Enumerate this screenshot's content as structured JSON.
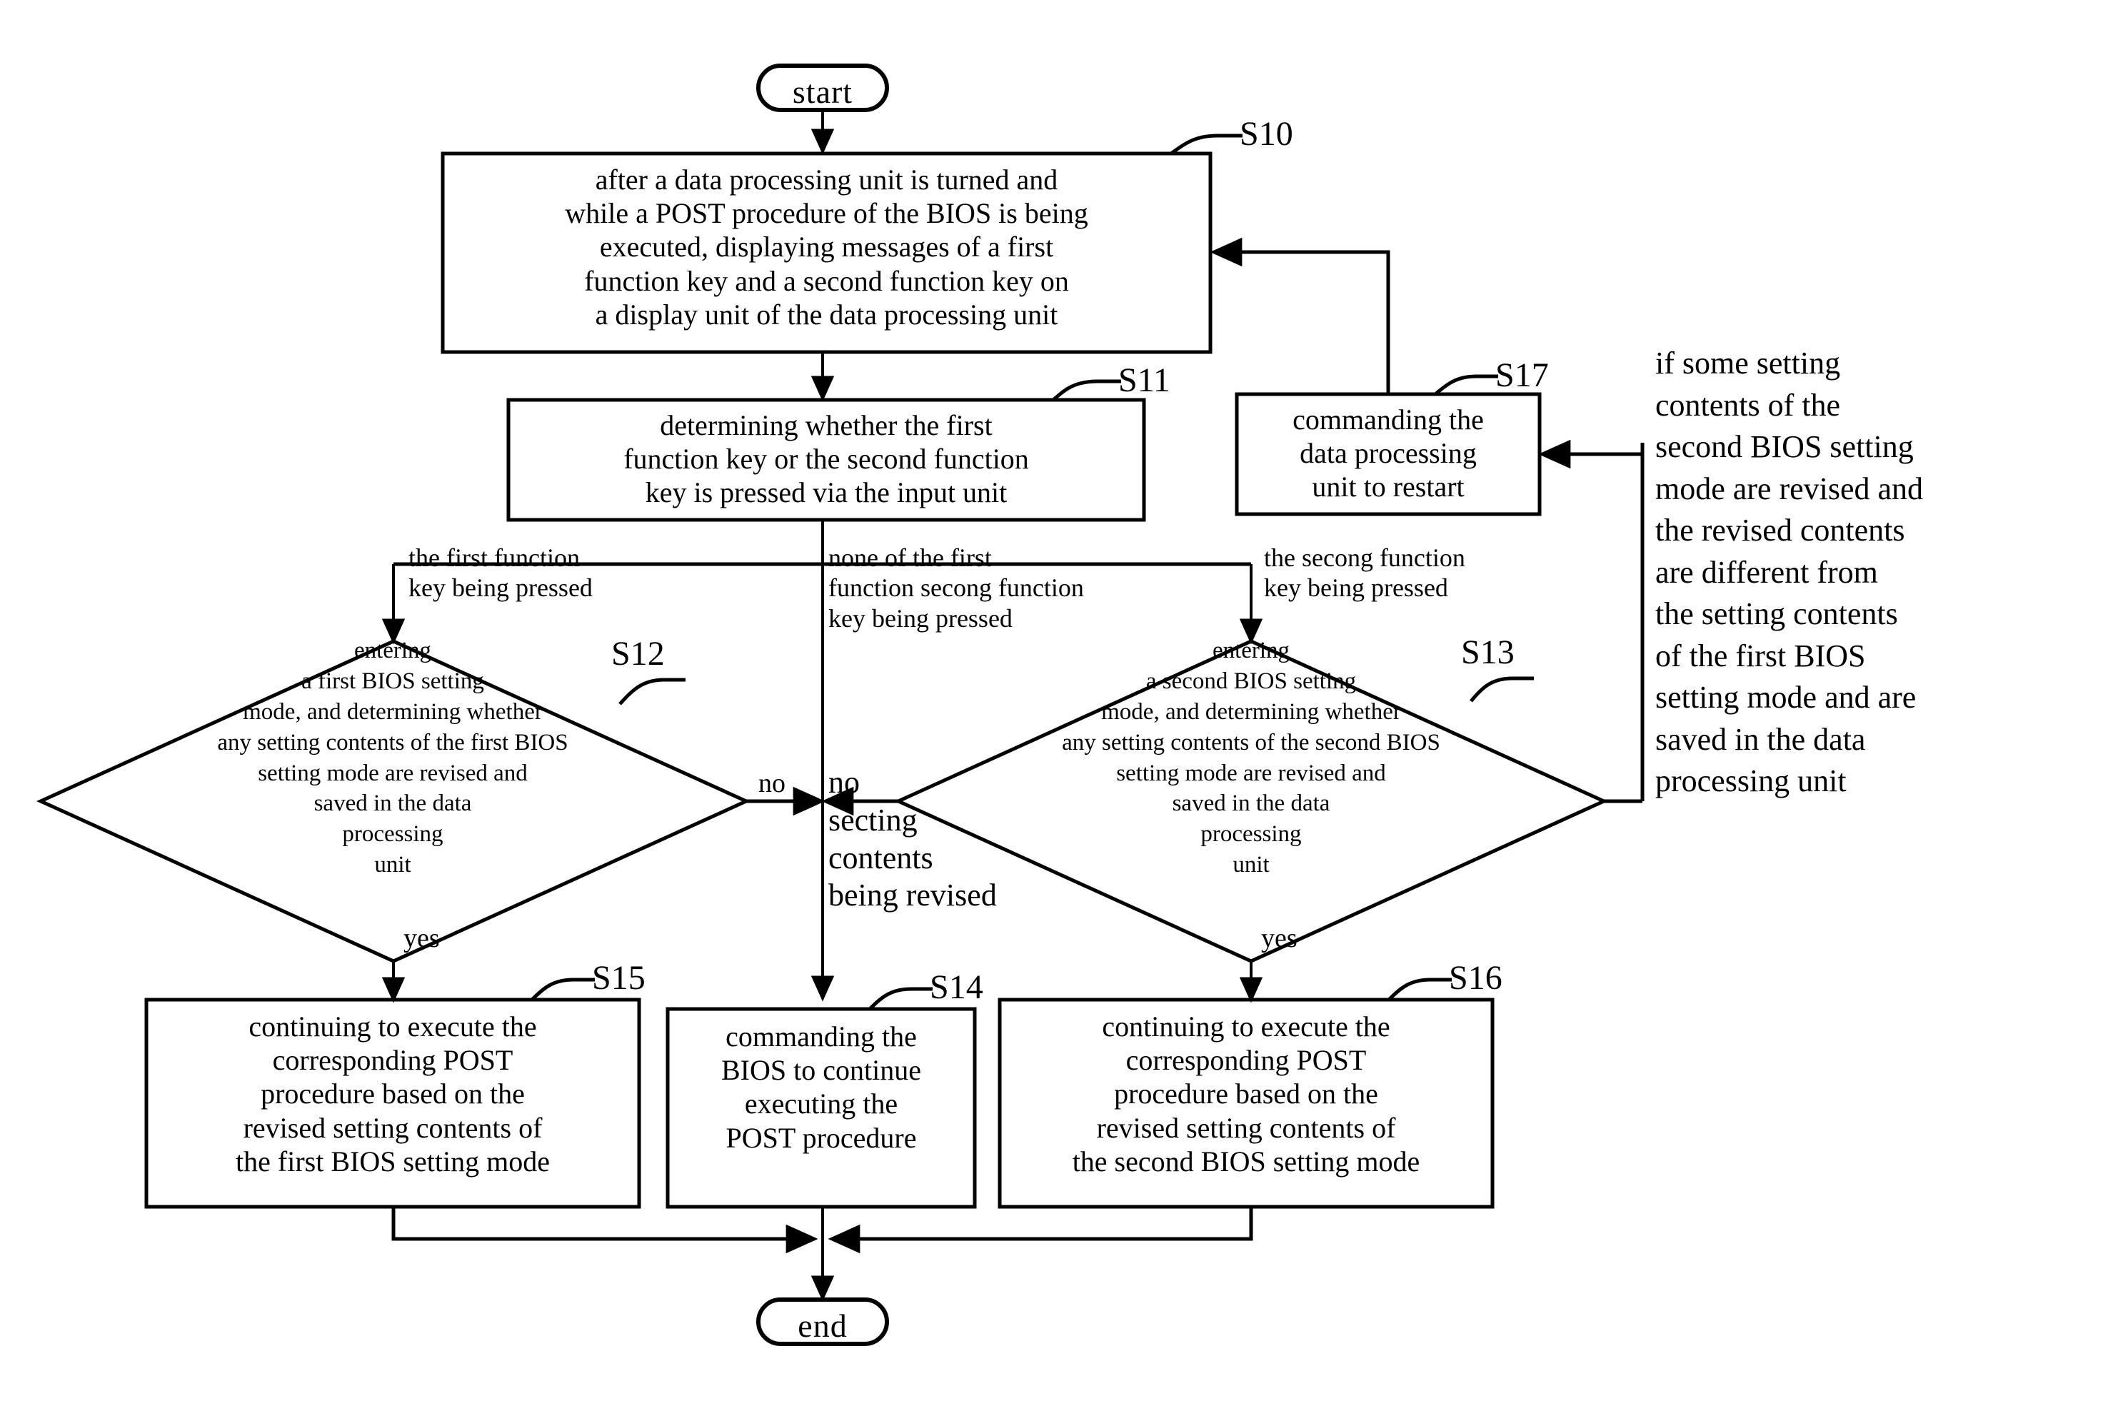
{
  "diagram": {
    "type": "flowchart",
    "title_visible": false,
    "nodes": {
      "start": {
        "label": "start",
        "shape": "terminal"
      },
      "end": {
        "label": "end",
        "shape": "terminal"
      },
      "s10": {
        "tag": "S10",
        "shape": "process",
        "label": "after a data processing unit is turned and\nwhile a POST procedure of the BIOS is being\nexecuted, displaying messages of a first\nfunction key and a second function key  on\na display unit of the data processing unit"
      },
      "s11": {
        "tag": "S11",
        "shape": "process",
        "label": "determining whether the first\nfunction key or the second function\nkey is pressed via the input unit"
      },
      "s12": {
        "tag": "S12",
        "shape": "decision",
        "label": "entering\na first BIOS setting\nmode, and determining whether\nany setting contents of the first BIOS\nsetting mode are revised and\nsaved in the data\nprocessing\nunit"
      },
      "s13": {
        "tag": "S13",
        "shape": "decision",
        "label": "entering\na second BIOS setting\nmode, and determining whether\nany setting contents of the second BIOS\nsetting mode are revised and\nsaved in the data\nprocessing\nunit"
      },
      "s14": {
        "tag": "S14",
        "shape": "process",
        "label": "commanding the\nBIOS to continue\nexecuting the\nPOST procedure"
      },
      "s15": {
        "tag": "S15",
        "shape": "process",
        "label": "continuing to execute the\ncorresponding POST\nprocedure based on the\nrevised setting contents of\nthe first BIOS setting mode"
      },
      "s16": {
        "tag": "S16",
        "shape": "process",
        "label": "continuing to execute the\ncorresponding POST\nprocedure based on  the\nrevised setting contents of\nthe second BIOS setting mode"
      },
      "s17": {
        "tag": "S17",
        "shape": "process",
        "label": "commanding the\ndata processing\nunit to restart"
      }
    },
    "edge_labels": {
      "first_key_pressed": "the first function\nkey being pressed",
      "none_pressed": "none of the first\nfunction secong function\nkey being pressed",
      "second_key_pressed": "the secong function\nkey being pressed",
      "no_left": "no",
      "no_center": "no\nsecting\ncontents\nbeing revised",
      "yes_left": "yes",
      "yes_right": "yes"
    },
    "annotations": {
      "right_note": "if some setting\ncontents of the\nsecond BIOS setting\nmode are revised and\nthe revised contents\nare different from\nthe setting contents\nof the first BIOS\nsetting mode and are\nsaved in the data\nprocessing unit"
    },
    "colors": {
      "stroke": "#000000",
      "fill": "#ffffff",
      "text": "#000000"
    }
  }
}
